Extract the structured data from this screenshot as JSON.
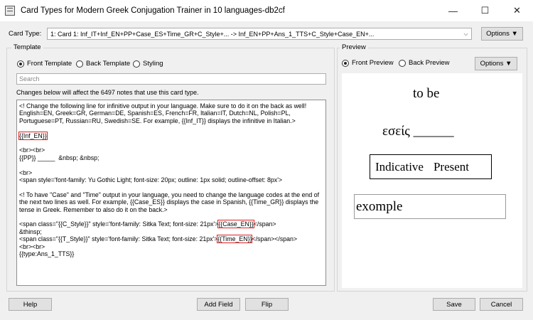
{
  "window": {
    "title": "Card Types for Modern Greek Conjugation Trainer in 10 languages-db2cf",
    "minimize": "—",
    "maximize": "☐",
    "close": "✕"
  },
  "card_type": {
    "label": "Card Type:",
    "value": "1: Card 1: Inf_IT+Inf_EN+PP+Case_ES+Time_GR+C_Style+... -> Inf_EN+PP+Ans_1_TTS+C_Style+Case_EN+...",
    "options_button": "Options ▼"
  },
  "template": {
    "group_title": "Template",
    "radios": [
      {
        "label": "Front Template",
        "checked": true
      },
      {
        "label": "Back Template",
        "checked": false
      },
      {
        "label": "Styling",
        "checked": false
      }
    ],
    "search_placeholder": "Search",
    "notice": "Changes below will affect the 6497 notes that use this card type.",
    "editor": {
      "p1": "<! Change the following line for infinitive output in your language. Make sure to do it on the back as well! English=EN, Greek=GR, German=DE, Spanish=ES, French=FR, Italian=IT, Dutch=NL, Polish=PL, Portuguese=PT, Russian=RU, Swedish=SE. For example, {{Inf_IT}} displays the infinitive in Italian.>",
      "inf_en": "{{Inf_EN}}",
      "br_br": "<br><br>",
      "pp_line": "{{PP}} _____  &nbsp; &nbsp;",
      "br": "<br>",
      "span_yu": "<span style='font-family: Yu Gothic Light; font-size: 20px; outline: 1px solid; outline-offset: 8px'>",
      "p2": "<! To have \"Case\" and \"Time\" output in your language, you need to change the language codes at the end of the next two lines as well. For example, {{Case_ES}} displays the case in Spanish, {{Time_GR}} displays the tense in Greek. Remember to also do it on the back.>",
      "span_c_pre": "<span class=\"{{C_Style}}\" style='font-family: Sitka Text; font-size: 21px'>",
      "case_en": "{{Case_EN}}",
      "span_c_post": "</span>",
      "thinsp": "&thinsp;",
      "span_t_pre": "<span class=\"{{T_Style}}\" style='font-family: Sitka Text; font-size: 21px'>",
      "time_en": "{{Time_EN}}",
      "span_t_post": "</span></span>",
      "br_br2": "<br><br>",
      "type_line": "{{type:Ans_1_TTS}}"
    }
  },
  "preview": {
    "group_title": "Preview",
    "radios": [
      {
        "label": "Front Preview",
        "checked": true
      },
      {
        "label": "Back Preview",
        "checked": false
      }
    ],
    "options_button": "Options ▼",
    "infinitive": "to be",
    "pronoun_line": "εσείς ______",
    "mood": "Indicative",
    "tense": "Present",
    "answer_value": "exomple"
  },
  "buttons": {
    "help": "Help",
    "add_field": "Add Field",
    "flip": "Flip",
    "save": "Save",
    "cancel": "Cancel"
  }
}
